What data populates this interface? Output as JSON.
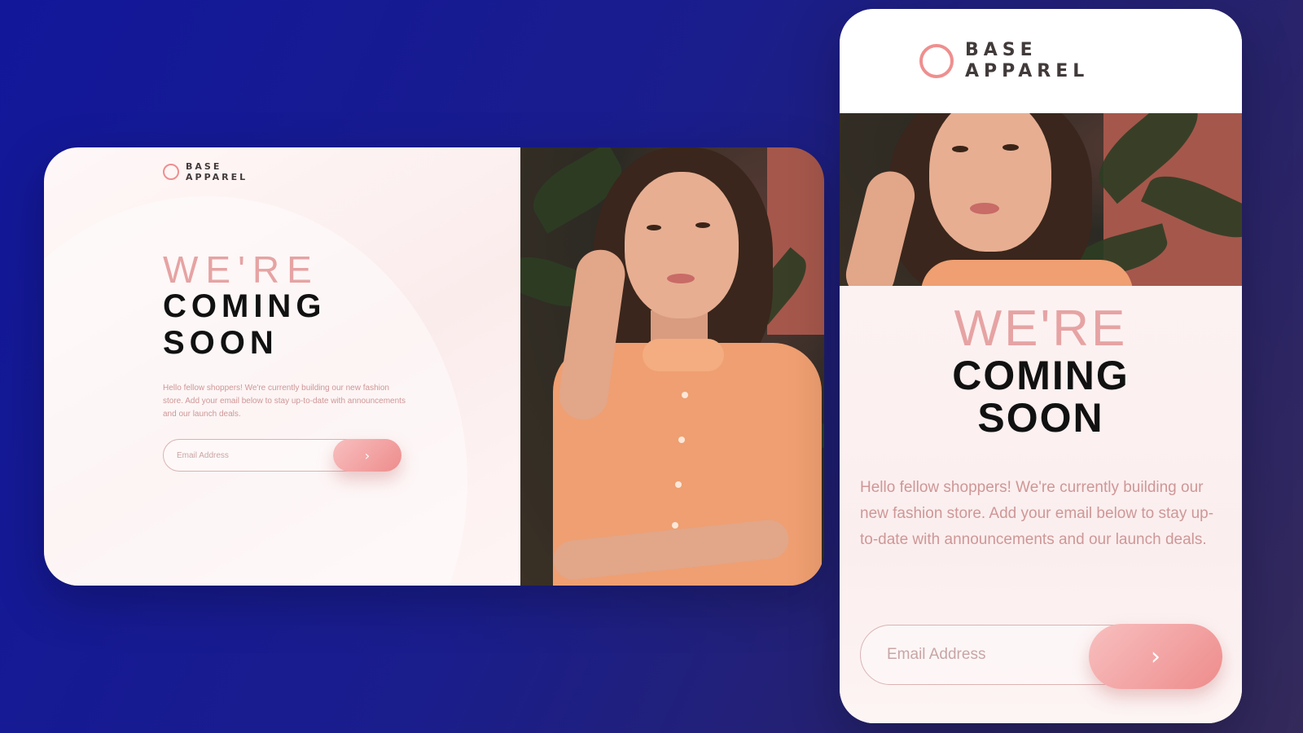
{
  "brand": {
    "line1": "BASE",
    "line2": "APPAREL",
    "accent_color": "#ef8f8f",
    "text_color": "#423a3a"
  },
  "hero": {
    "thin_heading": "WE'RE",
    "bold_line1": "COMING",
    "bold_line2": "SOON",
    "description": "Hello fellow shoppers! We're currently building our new fashion store. Add your email below to stay up-to-date with announcements and our launch deals."
  },
  "form": {
    "email_placeholder": "Email Address",
    "submit_icon": "chevron-right-icon",
    "submit_glyph": "›"
  },
  "photo": {
    "subject": "woman-in-orange-shirt-photo"
  },
  "colors": {
    "background_start": "#12179a",
    "background_end": "#342a5a",
    "heading_thin": "#e6a3a3",
    "heading_bold": "#111111",
    "paragraph": "#ce9797",
    "button_gradient_start": "#f8bfbf",
    "button_gradient_end": "#ee8c8c"
  }
}
